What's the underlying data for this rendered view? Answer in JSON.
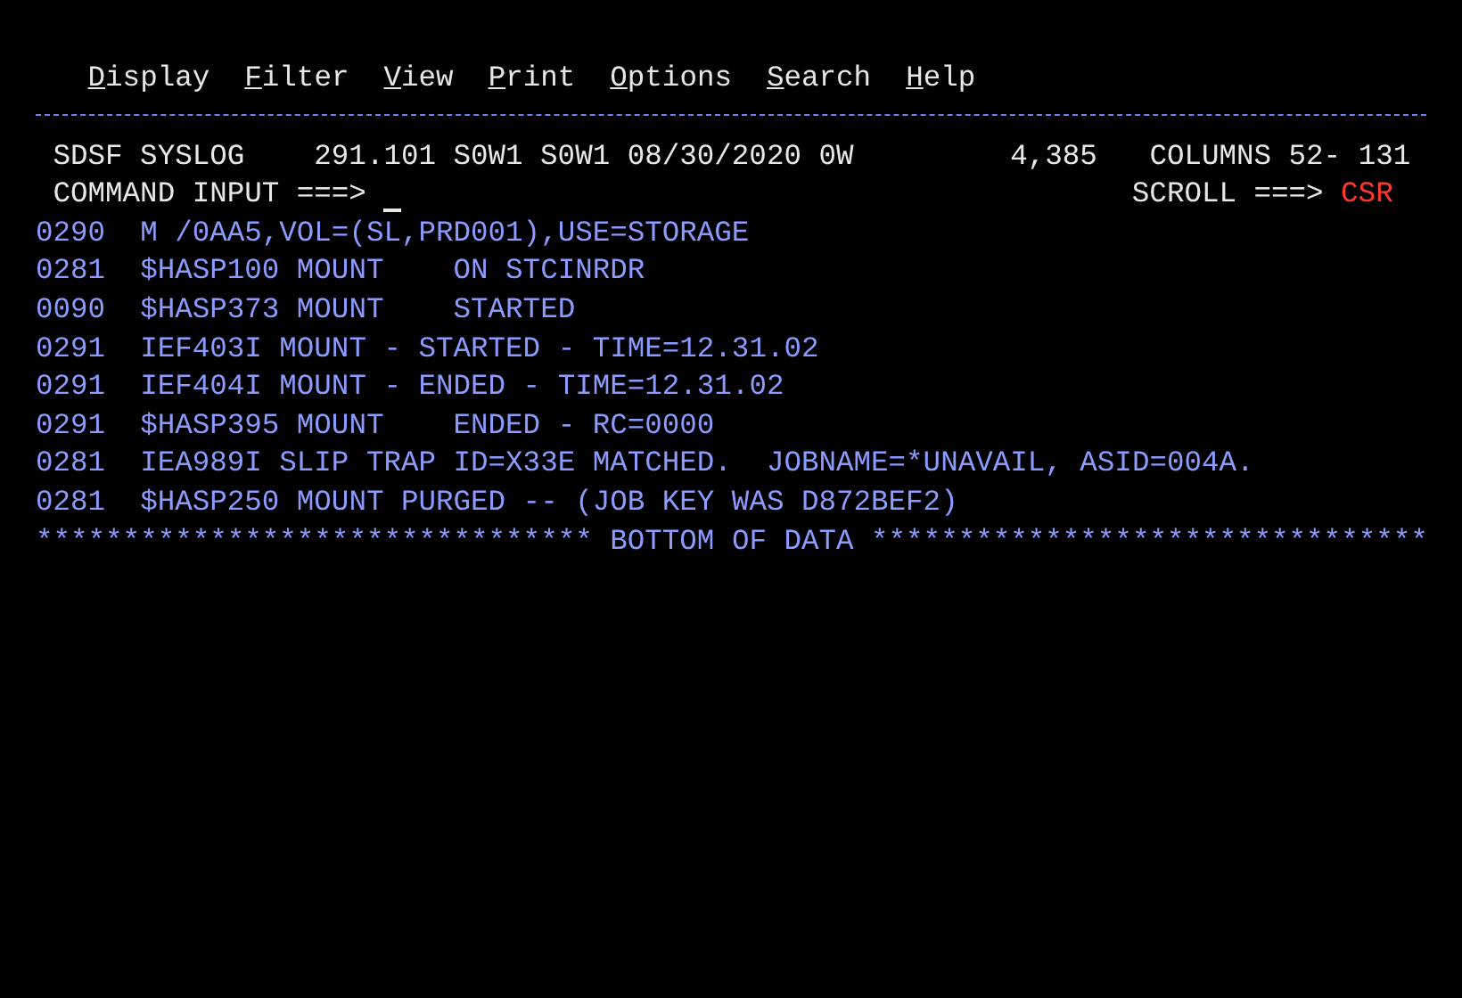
{
  "menu": [
    {
      "label": "Display"
    },
    {
      "label": "Filter"
    },
    {
      "label": "View"
    },
    {
      "label": "Print"
    },
    {
      "label": "Options"
    },
    {
      "label": "Search"
    },
    {
      "label": "Help"
    }
  ],
  "header": {
    "panel": "SDSF SYSLOG",
    "log_info": "291.101 S0W1 S0W1 08/30/2020 0W",
    "line_count": "4,385",
    "columns": "COLUMNS 52- 131"
  },
  "command": {
    "label": "COMMAND INPUT ===>",
    "scroll_label": "SCROLL ===>",
    "scroll_value": "CSR"
  },
  "log_lines": [
    {
      "number": "0290",
      "message": "M /0AA5,VOL=(SL,PRD001),USE=STORAGE"
    },
    {
      "number": "0281",
      "message": "$HASP100 MOUNT    ON STCINRDR"
    },
    {
      "number": "0090",
      "message": "$HASP373 MOUNT    STARTED"
    },
    {
      "number": "0291",
      "message": "IEF403I MOUNT - STARTED - TIME=12.31.02"
    },
    {
      "number": "0291",
      "message": "IEF404I MOUNT - ENDED - TIME=12.31.02"
    },
    {
      "number": "0291",
      "message": "$HASP395 MOUNT    ENDED - RC=0000"
    },
    {
      "number": "0281",
      "message": "IEA989I SLIP TRAP ID=X33E MATCHED.  JOBNAME=*UNAVAIL, ASID=004A."
    },
    {
      "number": "0281",
      "message": "$HASP250 MOUNT PURGED -- (JOB KEY WAS D872BEF2)"
    }
  ],
  "end_marker": "******************************** BOTTOM OF DATA ********************************"
}
